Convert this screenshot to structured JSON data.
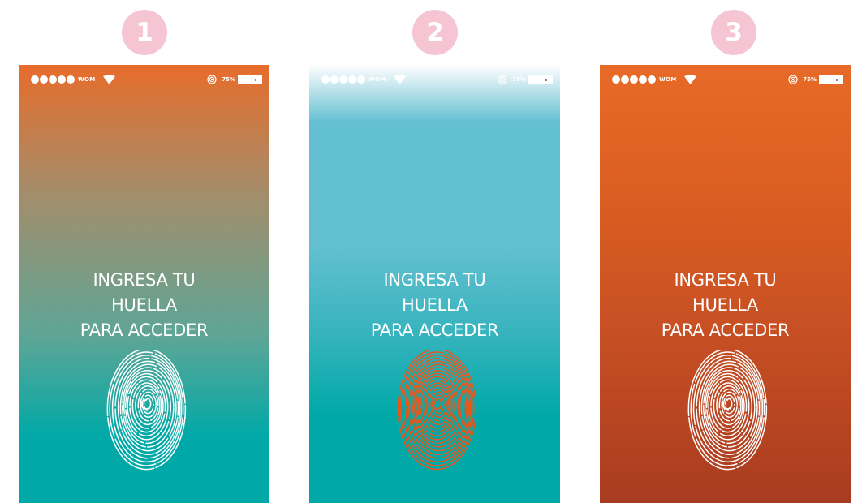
{
  "steps": [
    {
      "badge": "1",
      "carrier": "WOM",
      "battery": "75%",
      "prompt": [
        "INGRESA TU",
        "HUELLA",
        "PARA ACCEDER"
      ],
      "fingerprint_color": "#ffffff",
      "background": [
        "#e86c2b",
        "#00a9a7"
      ]
    },
    {
      "badge": "2",
      "carrier": "WOM",
      "battery": "75%",
      "prompt": [
        "INGRESA TU",
        "HUELLA",
        "PARA ACCEDER"
      ],
      "fingerprint_color": "#e8581d",
      "background": [
        "#62bfd0",
        "#00a9a7"
      ]
    },
    {
      "badge": "3",
      "carrier": "WOM",
      "battery": "75%",
      "prompt": [
        "INGRESA TU",
        "HUELLA",
        "PARA ACCEDER"
      ],
      "fingerprint_color": "#ffffff",
      "background": [
        "#e86a28",
        "#a83c20"
      ]
    }
  ],
  "icons": {
    "signal": "signal-dots-icon",
    "wifi": "wifi-icon",
    "nfc": "nfc-icon",
    "battery": "battery-icon",
    "fingerprint": "fingerprint-icon"
  },
  "colors": {
    "badge": "#f6c5d3",
    "orange": "#e86c2b",
    "teal": "#00a9a7",
    "light_blue": "#62bfd0"
  }
}
